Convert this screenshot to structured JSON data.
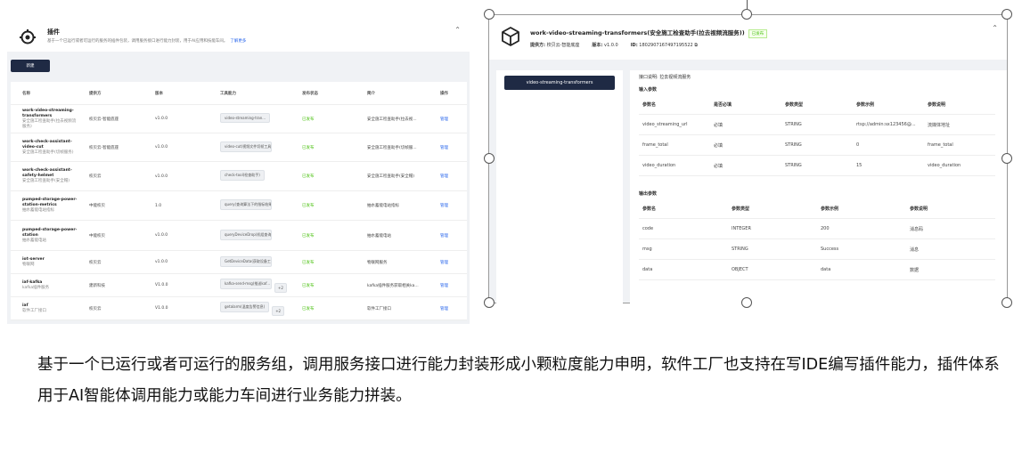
{
  "left_panel": {
    "title": "插件",
    "description": "基于一个已运行或者可运行的服务的插件包装，调用服务接口进行能力封装，用于AI应用和技能车间。",
    "learn_more": "了解更多",
    "new_button": "新建",
    "columns": [
      "名称",
      "提供方",
      "版本",
      "工具能力",
      "发布状态",
      "简介",
      "操作"
    ],
    "rows": [
      {
        "name": "work-video-streaming-transformers",
        "sub": "安全施工检查助手(拉去视频流服务)",
        "provider": "校贝云-智能底座",
        "version": "v1.0.0",
        "tool": "video-streaming-tran...",
        "extra": "",
        "status": "已发布",
        "intro": "安全施工检查助手(拉去视...",
        "action": "管理"
      },
      {
        "name": "work-check-assistant-video-cut",
        "sub": "安全施工检查助手(切帧服务)",
        "provider": "校贝云-智能底座",
        "version": "v1.0.0",
        "tool": "video-cut(视频文件切帧工具)",
        "extra": "",
        "status": "已发布",
        "intro": "安全施工检查助手(切帧服...",
        "action": "管理"
      },
      {
        "name": "work-check-assistant-safety-helmet",
        "sub": "安全施工检查助手(安全帽)",
        "provider": "校贝云",
        "version": "v1.0.0",
        "tool": "check-tool(检查助手)",
        "extra": "",
        "status": "已发布",
        "intro": "安全施工检查助手(安全帽)",
        "action": "管理"
      },
      {
        "name": "pumped-storage-power-station-metrics",
        "sub": "抽水蓄能电站指标",
        "provider": "中能校贝",
        "version": "1.0",
        "tool": "query(查询算法下的指标结果)",
        "extra": "",
        "status": "已发布",
        "intro": "抽水蓄能电站指标",
        "action": "管理"
      },
      {
        "name": "pumped-storage-power-station",
        "sub": "抽水蓄能电站",
        "provider": "中能校贝",
        "version": "v1.0.0",
        "tool": "queryDeviceDrop(机组查询...",
        "extra": "",
        "status": "已发布",
        "intro": "抽水蓄能电站",
        "action": "管理"
      },
      {
        "name": "iot-server",
        "sub": "物联网",
        "provider": "校贝云",
        "version": "v1.0.0",
        "tool": "GetDeviceData(获取设备工况...",
        "extra": "",
        "status": "已发布",
        "intro": "物联网服务",
        "action": "管理"
      },
      {
        "name": "iaf-kafka",
        "sub": "kafka插件服务",
        "provider": "建新科技",
        "version": "V1.0.0",
        "tool": "kafka-send-msg(推送kaf...",
        "extra": "+2",
        "status": "已发布",
        "intro": "kafka插件服务获取相关ka...",
        "action": "管理"
      },
      {
        "name": "iaf",
        "sub": "软件工厂接口",
        "provider": "校贝云",
        "version": "V1.0.0",
        "tool": "getalarm(温度告警信息)",
        "extra": "+2",
        "status": "已发布",
        "intro": "软件工厂接口",
        "action": "管理"
      }
    ]
  },
  "right_panel": {
    "title": "work-video-streaming-transformers(安全施工检查助手(拉去视频流服务))",
    "badge": "已发布",
    "provider_label": "提供方:",
    "provider": "校贝云-智能底座",
    "version_label": "版本:",
    "version": "v1.0.0",
    "id_label": "ID:",
    "id": "1802907167497195522",
    "side_button": "video-streaming-transformers",
    "api_desc": "接口说明: 拉去视频流服务",
    "input_title": "输入参数",
    "input_columns": [
      "参数名",
      "是否必填",
      "参数类型",
      "参数示例",
      "参数说明"
    ],
    "input_rows": [
      [
        "video_streaming_url",
        "必填",
        "STRING",
        "rtsp://admin:sx123456@...",
        "流媒体地址"
      ],
      [
        "frame_total",
        "必填",
        "STRING",
        "0",
        "frame_total"
      ],
      [
        "video_duration",
        "必填",
        "STRING",
        "15",
        "video_duration"
      ]
    ],
    "output_title": "输出参数",
    "output_columns": [
      "参数名",
      "参数类型",
      "参数示例",
      "参数说明"
    ],
    "output_rows": [
      [
        "code",
        "INTEGER",
        "200",
        "消息码"
      ],
      [
        "msg",
        "STRING",
        "Success",
        "消息"
      ],
      [
        "data",
        "OBJECT",
        "data",
        "数据"
      ]
    ]
  },
  "caption": "基于一个已运行或者可运行的服务组，调用服务接口进行能力封装形成小颗粒度能力申明，软件工厂也支持在写IDE编写插件能力，插件体系用于AI智能体调用能力或能力车间进行业务能力拼装。"
}
